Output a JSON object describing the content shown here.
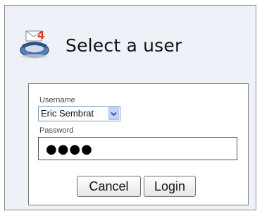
{
  "header": {
    "title": "Select a user",
    "logo_icon": "phone-mail-icon"
  },
  "form": {
    "username_label": "Username",
    "username_value": "Eric Sembrat",
    "password_label": "Password",
    "password_value": "●●●●"
  },
  "buttons": {
    "cancel": "Cancel",
    "login": "Login"
  },
  "colors": {
    "window_bg": "#eef1f7",
    "dropdown_button": "#c1d3fb",
    "logo_badge": "#e8352f"
  }
}
